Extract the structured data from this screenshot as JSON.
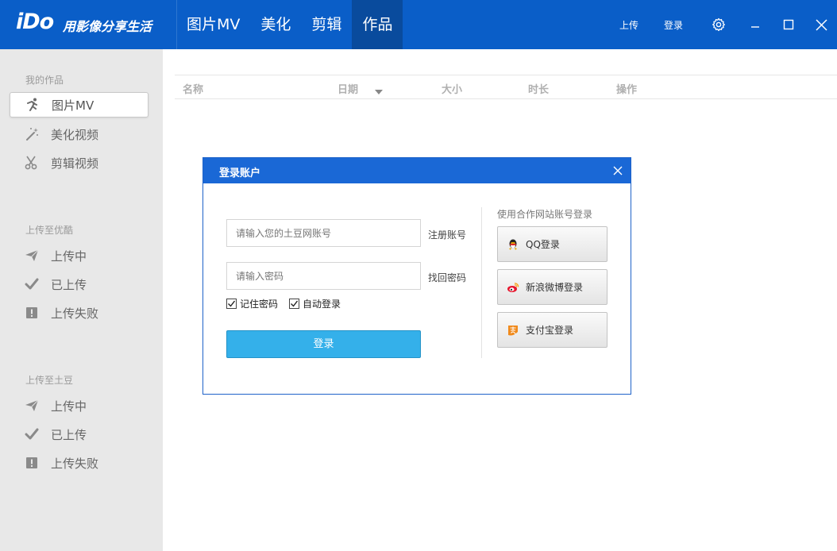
{
  "app": {
    "logo": "iDo",
    "slogan": "用影像分享生活",
    "nav_tabs": [
      {
        "label": "图片MV",
        "active": false
      },
      {
        "label": "美化",
        "active": false
      },
      {
        "label": "剪辑",
        "active": false
      },
      {
        "label": "作品",
        "active": true
      }
    ],
    "upload_label": "上传",
    "login_label": "登录",
    "accent_color": "#0a5ec8"
  },
  "sidebar": {
    "sections": [
      {
        "title": "我的作品",
        "items": [
          {
            "label": "图片MV",
            "icon": "runner-icon",
            "active": true
          },
          {
            "label": "美化视频",
            "icon": "magic-wand-icon",
            "active": false
          },
          {
            "label": "剪辑视频",
            "icon": "scissors-icon",
            "active": false
          }
        ]
      },
      {
        "title": "上传至优酷",
        "items": [
          {
            "label": "上传中",
            "icon": "paper-plane-icon"
          },
          {
            "label": "已上传",
            "icon": "checkmark-icon"
          },
          {
            "label": "上传失败",
            "icon": "exclamation-icon"
          }
        ]
      },
      {
        "title": "上传至土豆",
        "items": [
          {
            "label": "上传中",
            "icon": "paper-plane-icon"
          },
          {
            "label": "已上传",
            "icon": "checkmark-icon"
          },
          {
            "label": "上传失败",
            "icon": "exclamation-icon"
          }
        ]
      }
    ]
  },
  "table": {
    "columns": [
      "名称",
      "日期",
      "大小",
      "时长",
      "操作"
    ],
    "sorted_column": "日期"
  },
  "dialog": {
    "title": "登录账户",
    "account_placeholder": "请输入您的土豆网账号",
    "password_placeholder": "请输入密码",
    "register_link": "注册账号",
    "recover_link": "找回密码",
    "remember_label": "记住密码",
    "remember_checked": true,
    "auto_login_label": "自动登录",
    "auto_login_checked": true,
    "submit_label": "登录",
    "partner_title": "使用合作网站账号登录",
    "partners": [
      {
        "label": "QQ登录",
        "icon": "qq-penguin-icon"
      },
      {
        "label": "新浪微博登录",
        "icon": "weibo-icon"
      },
      {
        "label": "支付宝登录",
        "icon": "alipay-icon"
      }
    ]
  }
}
